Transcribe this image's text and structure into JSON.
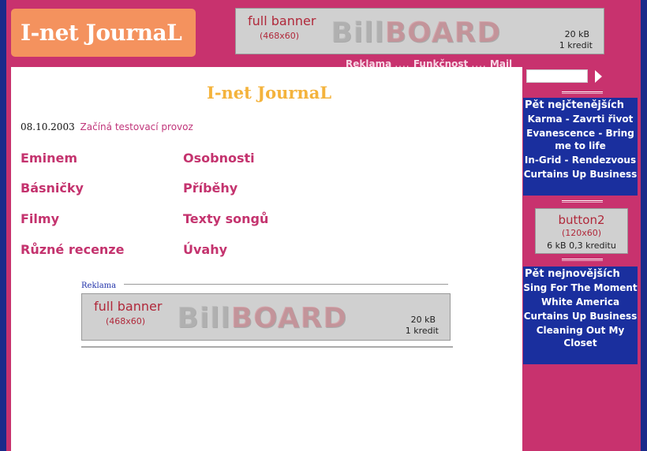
{
  "logo": {
    "text": "I-net JournaL"
  },
  "top_banner": {
    "title": "full banner",
    "size": "(468x60)",
    "brand_a": "Bill",
    "brand_b": "BOARD",
    "kb": "20 kB",
    "credit": "1 kredit"
  },
  "topnav": {
    "link1": "Reklama",
    "sep1": "....",
    "link2": "Funkčnost",
    "sep2": "....",
    "link3": "Mail"
  },
  "main": {
    "title": "I-net JournaL",
    "news_date": "08.10.2003",
    "news_headline": "Začíná testovací provoz",
    "categories": [
      "Eminem",
      "Osobnosti",
      "Básničky",
      "Příběhy",
      "Filmy",
      "Texty songů",
      "Různé recenze",
      "Úvahy"
    ],
    "ad_label": "Reklama"
  },
  "main_banner": {
    "title": "full banner",
    "size": "(468x60)",
    "brand_a": "Bill",
    "brand_b": "BOARD",
    "kb": "20 kB",
    "credit": "1 kredit"
  },
  "sidebar": {
    "top_read": {
      "heading": "Pět nejčtenějších",
      "items": [
        "Karma - Zavrti řivot",
        "Evanescence - Bring me to life",
        "In-Grid - Rendezvous",
        "Curtains Up Business"
      ]
    },
    "button2": {
      "title": "button2",
      "size": "(120x60)",
      "info": "6 kB    0,3 kreditu"
    },
    "newest": {
      "heading": "Pět nejnovějších",
      "items": [
        "Sing For The Moment",
        "White America",
        "Curtains Up Business",
        "Cleaning Out My Closet"
      ]
    }
  },
  "colors": {
    "background": "#c8326e",
    "frame": "#1a2a8a",
    "logo_bg": "#f4925e",
    "title": "#f4b33c",
    "link": "#c4336e",
    "sidebar_box": "#1a2f9e"
  }
}
